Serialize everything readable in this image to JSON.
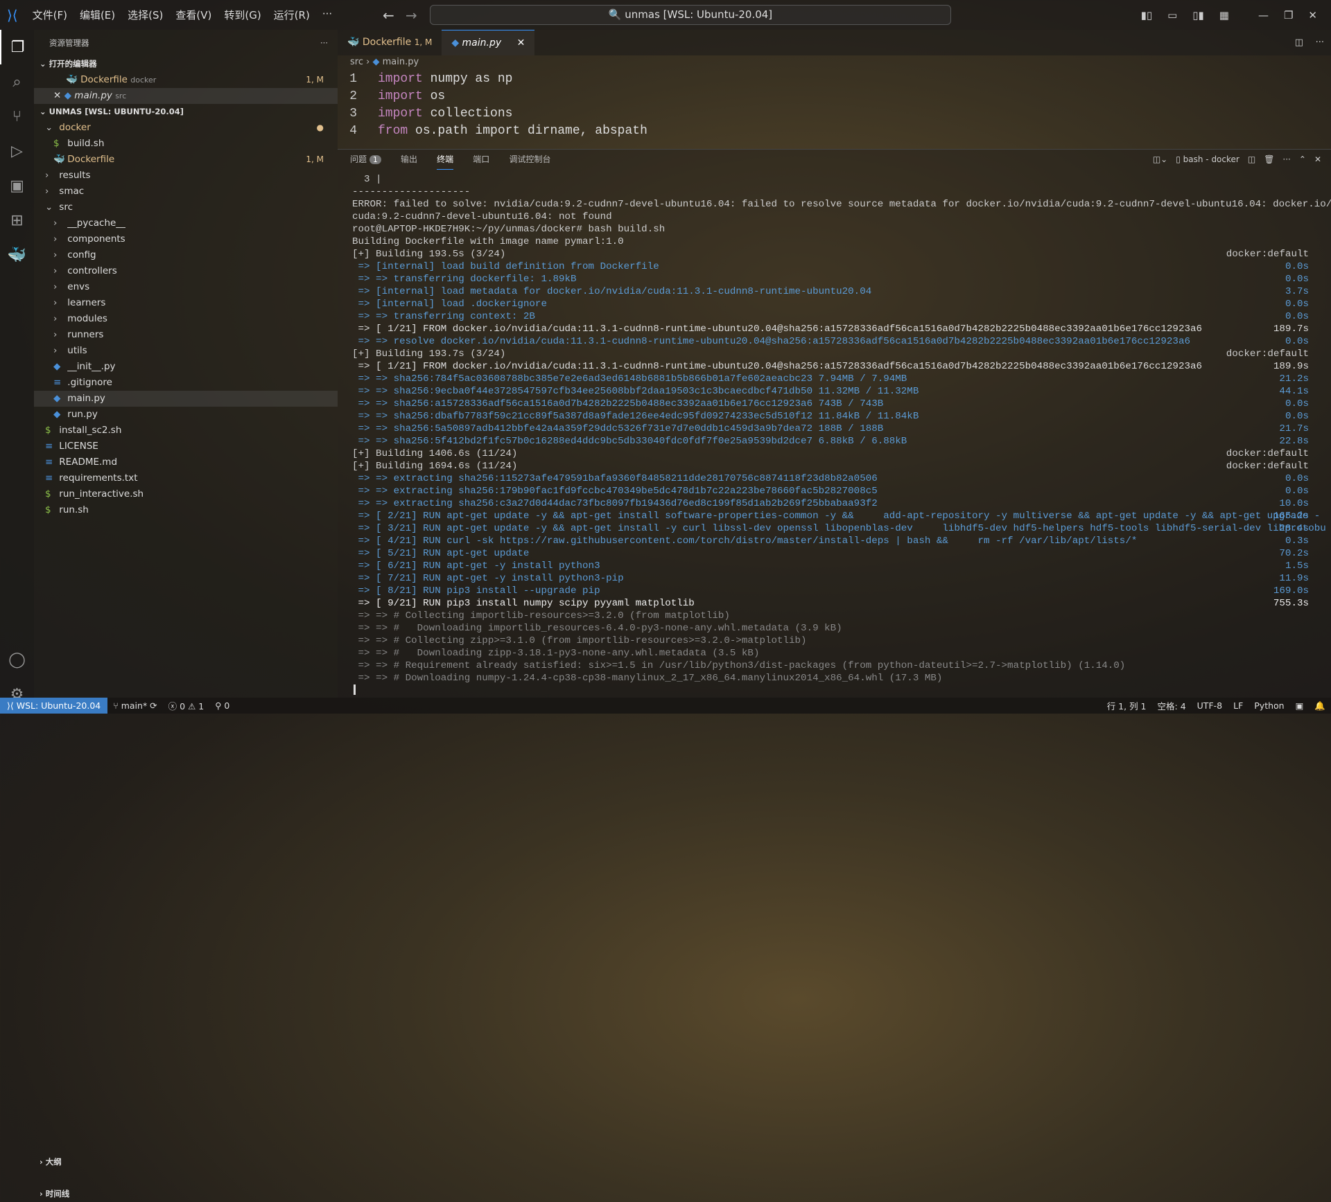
{
  "menu": [
    "文件(F)",
    "编辑(E)",
    "选择(S)",
    "查看(V)",
    "转到(G)",
    "运行(R)",
    "···"
  ],
  "search": "unmas [WSL: Ubuntu-20.04]",
  "sidebar": {
    "title": "资源管理器",
    "open_editors": "打开的编辑器",
    "open_files": [
      {
        "name": "Dockerfile",
        "desc": "docker",
        "badge": "1, M"
      },
      {
        "name": "main.py",
        "desc": "src",
        "badge": ""
      }
    ],
    "workspace": "UNMAS [WSL: UBUNTU-20.04]",
    "tree": [
      {
        "name": "docker",
        "lvl": 0,
        "type": "open",
        "color": "#e2c08d"
      },
      {
        "name": "build.sh",
        "lvl": 1,
        "type": "file",
        "color": "#ddd"
      },
      {
        "name": "Dockerfile",
        "lvl": 1,
        "type": "file",
        "color": "#e2c08d",
        "badge": "1, M"
      },
      {
        "name": "results",
        "lvl": 0,
        "type": "closed",
        "color": "#ddd"
      },
      {
        "name": "smac",
        "lvl": 0,
        "type": "closed",
        "color": "#ddd"
      },
      {
        "name": "src",
        "lvl": 0,
        "type": "open",
        "color": "#ddd"
      },
      {
        "name": "__pycache__",
        "lvl": 1,
        "type": "closed",
        "color": "#ddd"
      },
      {
        "name": "components",
        "lvl": 1,
        "type": "closed",
        "color": "#ddd"
      },
      {
        "name": "config",
        "lvl": 1,
        "type": "closed",
        "color": "#ddd"
      },
      {
        "name": "controllers",
        "lvl": 1,
        "type": "closed",
        "color": "#ddd"
      },
      {
        "name": "envs",
        "lvl": 1,
        "type": "closed",
        "color": "#ddd"
      },
      {
        "name": "learners",
        "lvl": 1,
        "type": "closed",
        "color": "#ddd"
      },
      {
        "name": "modules",
        "lvl": 1,
        "type": "closed",
        "color": "#ddd"
      },
      {
        "name": "runners",
        "lvl": 1,
        "type": "closed",
        "color": "#ddd"
      },
      {
        "name": "utils",
        "lvl": 1,
        "type": "closed",
        "color": "#ddd"
      },
      {
        "name": "__init__.py",
        "lvl": 1,
        "type": "file",
        "color": "#ddd"
      },
      {
        "name": ".gitignore",
        "lvl": 1,
        "type": "file",
        "color": "#ddd"
      },
      {
        "name": "main.py",
        "lvl": 1,
        "type": "file",
        "color": "#ddd",
        "selected": true
      },
      {
        "name": "run.py",
        "lvl": 1,
        "type": "file",
        "color": "#ddd"
      },
      {
        "name": "install_sc2.sh",
        "lvl": 0,
        "type": "file",
        "color": "#ddd"
      },
      {
        "name": "LICENSE",
        "lvl": 0,
        "type": "file",
        "color": "#ddd"
      },
      {
        "name": "README.md",
        "lvl": 0,
        "type": "file",
        "color": "#ddd"
      },
      {
        "name": "requirements.txt",
        "lvl": 0,
        "type": "file",
        "color": "#ddd"
      },
      {
        "name": "run_interactive.sh",
        "lvl": 0,
        "type": "file",
        "color": "#ddd"
      },
      {
        "name": "run.sh",
        "lvl": 0,
        "type": "file",
        "color": "#ddd"
      }
    ],
    "outline": "大纲",
    "timeline": "时间线"
  },
  "tabs": [
    {
      "label": "Dockerfile",
      "badge": "1, M"
    },
    {
      "label": "main.py"
    }
  ],
  "breadcrumb": [
    "src",
    "main.py"
  ],
  "code": [
    {
      "n": "1",
      "kw": "import",
      "rest": " numpy as np"
    },
    {
      "n": "2",
      "kw": "import",
      "rest": " os"
    },
    {
      "n": "3",
      "kw": "import",
      "rest": " collections"
    },
    {
      "n": "4",
      "kw": "from",
      "rest": " os.path import dirname, abspath"
    }
  ],
  "panel": {
    "tabs": [
      "问题",
      "输出",
      "终端",
      "端口",
      "调试控制台"
    ],
    "problems_count": "1",
    "terminal_name": "bash - docker"
  },
  "terminal": [
    {
      "t": "  3 |",
      "c": "#ccc"
    },
    {
      "t": "--------------------",
      "c": "#ccc"
    },
    {
      "t": "ERROR: failed to solve: nvidia/cuda:9.2-cudnn7-devel-ubuntu16.04: failed to resolve source metadata for docker.io/nvidia/cuda:9.2-cudnn7-devel-ubuntu16.04: docker.io/nvidia/",
      "c": "#ccc"
    },
    {
      "t": "cuda:9.2-cudnn7-devel-ubuntu16.04: not found",
      "c": "#ccc"
    },
    {
      "t": "root@LAPTOP-HKDE7H9K:~/py/unmas/docker# bash build.sh",
      "c": "#ccc"
    },
    {
      "t": "Building Dockerfile with image name pymarl:1.0",
      "c": "#ccc"
    },
    {
      "t": "[+] Building 193.5s (3/24)",
      "c": "#ccc",
      "time": "docker:default"
    },
    {
      "t": " => [internal] load build definition from Dockerfile",
      "c": "#5b9bd5",
      "time": "0.0s"
    },
    {
      "t": " => => transferring dockerfile: 1.89kB",
      "c": "#5b9bd5",
      "time": "0.0s"
    },
    {
      "t": " => [internal] load metadata for docker.io/nvidia/cuda:11.3.1-cudnn8-runtime-ubuntu20.04",
      "c": "#5b9bd5",
      "time": "3.7s"
    },
    {
      "t": " => [internal] load .dockerignore",
      "c": "#5b9bd5",
      "time": "0.0s"
    },
    {
      "t": " => => transferring context: 2B",
      "c": "#5b9bd5",
      "time": "0.0s"
    },
    {
      "t": " => [ 1/21] FROM docker.io/nvidia/cuda:11.3.1-cudnn8-runtime-ubuntu20.04@sha256:a15728336adf56ca1516a0d7b4282b2225b0488ec3392aa01b6e176cc12923a6",
      "c": "#ddd",
      "time": "189.7s"
    },
    {
      "t": " => => resolve docker.io/nvidia/cuda:11.3.1-cudnn8-runtime-ubuntu20.04@sha256:a15728336adf56ca1516a0d7b4282b2225b0488ec3392aa01b6e176cc12923a6",
      "c": "#5b9bd5",
      "time": "0.0s"
    },
    {
      "t": "[+] Building 193.7s (3/24)",
      "c": "#ccc",
      "time": "docker:default"
    },
    {
      "t": " => [ 1/21] FROM docker.io/nvidia/cuda:11.3.1-cudnn8-runtime-ubuntu20.04@sha256:a15728336adf56ca1516a0d7b4282b2225b0488ec3392aa01b6e176cc12923a6",
      "c": "#ddd",
      "time": "189.9s"
    },
    {
      "t": " => => sha256:784f5ac03608788bc385e7e2e6ad3ed6148b6881b5b866b01a7fe602aeacbc23 7.94MB / 7.94MB",
      "c": "#5b9bd5",
      "time": "21.2s"
    },
    {
      "t": " => => sha256:9ecba0f44e3728547597cfb34ee25608bbf2daa19503c1c3bcaecdbcf471db50 11.32MB / 11.32MB",
      "c": "#5b9bd5",
      "time": "44.1s"
    },
    {
      "t": " => => sha256:a15728336adf56ca1516a0d7b4282b2225b0488ec3392aa01b6e176cc12923a6 743B / 743B",
      "c": "#5b9bd5",
      "time": "0.0s"
    },
    {
      "t": " => => sha256:dbafb7783f59c21cc89f5a387d8a9fade126ee4edc95fd09274233ec5d510f12 11.84kB / 11.84kB",
      "c": "#5b9bd5",
      "time": "0.0s"
    },
    {
      "t": " => => sha256:5a50897adb412bbfe42a4a359f29ddc5326f731e7d7e0ddb1c459d3a9b7dea72 188B / 188B",
      "c": "#5b9bd5",
      "time": "21.7s"
    },
    {
      "t": " => => sha256:5f412bd2f1fc57b0c16288ed4ddc9bc5db33040fdc0fdf7f0e25a9539bd2dce7 6.88kB / 6.88kB",
      "c": "#5b9bd5",
      "time": "22.8s"
    },
    {
      "t": "[+] Building 1406.6s (11/24)",
      "c": "#ccc",
      "time": "docker:default"
    },
    {
      "t": "[+] Building 1694.6s (11/24)",
      "c": "#ccc",
      "time": "docker:default"
    },
    {
      "t": " => => extracting sha256:115273afe479591bafa9360f84858211dde28170756c8874118f23d8b82a0506",
      "c": "#5b9bd5",
      "time": "0.0s"
    },
    {
      "t": " => => extracting sha256:179b90fac1fd9fccbc470349be5dc478d1b7c22a223be78660fac5b2827008c5",
      "c": "#5b9bd5",
      "time": "0.0s"
    },
    {
      "t": " => => extracting sha256:c3a27d0d44dac73fbc8097fb19436d76ed8c199f85d1ab2b269f25bbabaa93f2",
      "c": "#5b9bd5",
      "time": "10.0s"
    },
    {
      "t": " => [ 2/21] RUN apt-get update -y && apt-get install software-properties-common -y &&     add-apt-repository -y multiverse && apt-get update -y && apt-get upgrade -",
      "c": "#5b9bd5",
      "time": "165.2s"
    },
    {
      "t": " => [ 3/21] RUN apt-get update -y && apt-get install -y curl libssl-dev openssl libopenblas-dev     libhdf5-dev hdf5-helpers hdf5-tools libhdf5-serial-dev libprotobu",
      "c": "#5b9bd5",
      "time": "28.4s"
    },
    {
      "t": " => [ 4/21] RUN curl -sk https://raw.githubusercontent.com/torch/distro/master/install-deps | bash &&     rm -rf /var/lib/apt/lists/*",
      "c": "#5b9bd5",
      "time": "0.3s"
    },
    {
      "t": " => [ 5/21] RUN apt-get update",
      "c": "#5b9bd5",
      "time": "70.2s"
    },
    {
      "t": " => [ 6/21] RUN apt-get -y install python3",
      "c": "#5b9bd5",
      "time": "1.5s"
    },
    {
      "t": " => [ 7/21] RUN apt-get -y install python3-pip",
      "c": "#5b9bd5",
      "time": "11.9s"
    },
    {
      "t": " => [ 8/21] RUN pip3 install --upgrade pip",
      "c": "#5b9bd5",
      "time": "169.0s"
    },
    {
      "t": " => [ 9/21] RUN pip3 install numpy scipy pyyaml matplotlib",
      "c": "#eee",
      "time": "755.3s"
    },
    {
      "t": " => => # Collecting importlib-resources>=3.2.0 (from matplotlib)",
      "c": "#888"
    },
    {
      "t": " => => #   Downloading importlib_resources-6.4.0-py3-none-any.whl.metadata (3.9 kB)",
      "c": "#888"
    },
    {
      "t": " => => # Collecting zipp>=3.1.0 (from importlib-resources>=3.2.0->matplotlib)",
      "c": "#888"
    },
    {
      "t": " => => #   Downloading zipp-3.18.1-py3-none-any.whl.metadata (3.5 kB)",
      "c": "#888"
    },
    {
      "t": " => => # Requirement already satisfied: six>=1.5 in /usr/lib/python3/dist-packages (from python-dateutil>=2.7->matplotlib) (1.14.0)",
      "c": "#888"
    },
    {
      "t": " => => # Downloading numpy-1.24.4-cp38-cp38-manylinux_2_17_x86_64.manylinux2014_x86_64.whl (17.3 MB)",
      "c": "#888"
    }
  ],
  "status": {
    "remote": "WSL: Ubuntu-20.04",
    "branch": "main*",
    "errors": "0",
    "warnings": "1",
    "ports": "0",
    "position": "行 1, 列 1",
    "spaces": "空格: 4",
    "encoding": "UTF-8",
    "eol": "LF",
    "language": "Python"
  },
  "colors": {
    "accent": "#3794ff",
    "remote_bg": "#3a7cc4",
    "modified": "#e2c08d"
  }
}
